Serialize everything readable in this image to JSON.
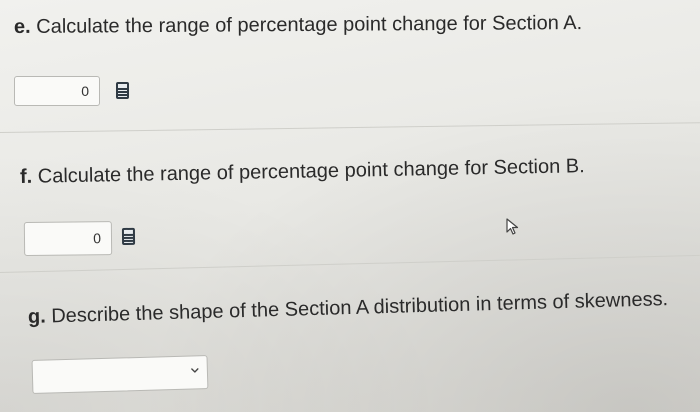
{
  "questions": [
    {
      "letter": "e.",
      "text": "Calculate the range of percentage point change for Section A.",
      "input_value": "0"
    },
    {
      "letter": "f.",
      "text": "Calculate the range of percentage point change for Section B.",
      "input_value": "0"
    },
    {
      "letter": "g.",
      "text": "Describe the shape of the Section A distribution in terms of skewness.",
      "select_value": ""
    }
  ]
}
